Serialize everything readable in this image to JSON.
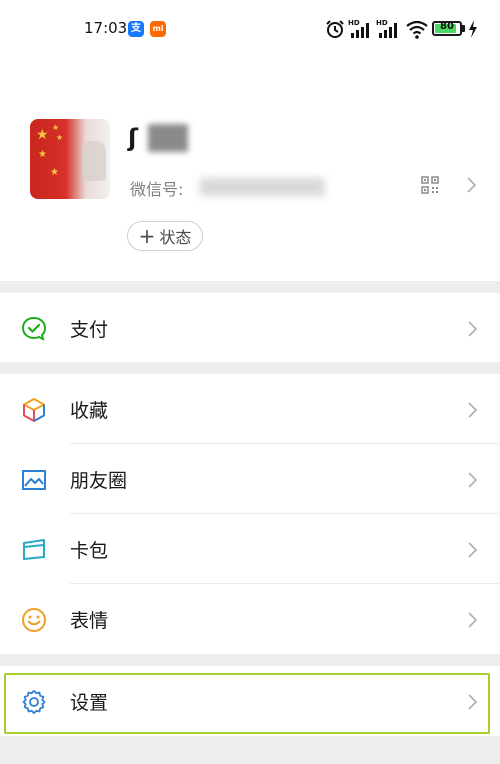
{
  "status_bar": {
    "time": "17:03",
    "alipay_badge": "支",
    "mi_badge": "mi",
    "battery_level": "80",
    "battery_fraction": 0.8,
    "hd_label": "HD",
    "icons": [
      "alarm-icon",
      "signal-hd-icon",
      "signal-hd-icon",
      "wifi-icon",
      "battery-icon",
      "charging-icon"
    ]
  },
  "profile": {
    "nickname_visible": "ʃ",
    "wechat_id_label": "微信号: ",
    "status_button": "状态",
    "status_plus": "+"
  },
  "menu": {
    "pay": {
      "label": "支付",
      "icon": "pay-icon",
      "color": "#1aad19"
    },
    "favorites": {
      "label": "收藏",
      "icon": "cube-icon"
    },
    "moments": {
      "label": "朋友圈",
      "icon": "image-icon",
      "color": "#2b7fd4"
    },
    "cards": {
      "label": "卡包",
      "icon": "card-icon",
      "color": "#2aa8c4"
    },
    "stickers": {
      "label": "表情",
      "icon": "smile-icon",
      "color": "#f0a020"
    },
    "settings": {
      "label": "设置",
      "icon": "gear-icon",
      "color": "#2b7fd4"
    }
  },
  "colors": {
    "background": "#ededed",
    "highlight_border": "#a4cf2c",
    "battery_green": "#4cd964"
  }
}
